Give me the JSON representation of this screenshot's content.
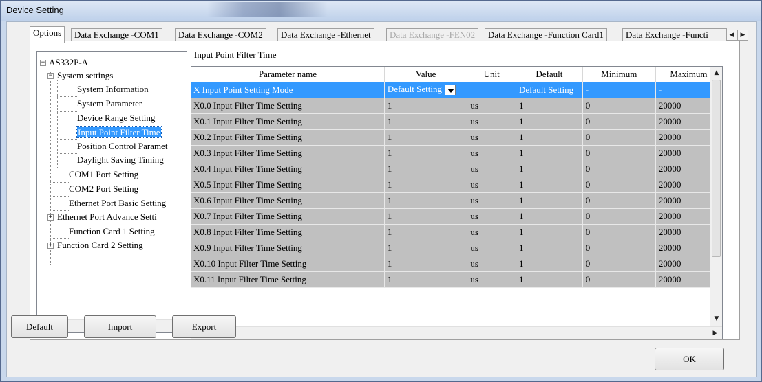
{
  "window": {
    "title": "Device Setting"
  },
  "tabs": [
    {
      "label": "Options",
      "state": "active"
    },
    {
      "label": "Data Exchange -COM1",
      "state": "normal"
    },
    {
      "label": "Data Exchange -COM2",
      "state": "normal"
    },
    {
      "label": "Data Exchange -Ethernet",
      "state": "normal"
    },
    {
      "label": "Data Exchange -FEN02",
      "state": "disabled"
    },
    {
      "label": "Data Exchange -Function Card1",
      "state": "normal"
    },
    {
      "label": "Data Exchange -Functi",
      "state": "normal"
    }
  ],
  "tab_scroll": {
    "left": "◀",
    "right": "▶"
  },
  "tree": {
    "items": [
      {
        "label": "AS332P-A",
        "expander": "−",
        "selected": false
      },
      {
        "label": "System settings",
        "expander": "−",
        "selected": false
      },
      {
        "label": "System Information",
        "selected": false
      },
      {
        "label": "System Parameter",
        "selected": false
      },
      {
        "label": "Device Range Setting",
        "selected": false
      },
      {
        "label": "Input Point Filter Time",
        "selected": true
      },
      {
        "label": "Position Control Paramet",
        "selected": false
      },
      {
        "label": "Daylight Saving Timing",
        "selected": false
      },
      {
        "label": "COM1 Port Setting",
        "selected": false
      },
      {
        "label": "COM2 Port Setting",
        "selected": false
      },
      {
        "label": "Ethernet Port Basic Setting",
        "selected": false
      },
      {
        "label": "Ethernet Port Advance Setti",
        "expander": "+",
        "selected": false
      },
      {
        "label": "Function Card 1 Setting",
        "selected": false
      },
      {
        "label": "Function Card 2 Setting",
        "expander": "+",
        "selected": false
      }
    ],
    "scroll_left": "◀",
    "scroll_right": "▶"
  },
  "grid": {
    "title": "Input Point Filter Time",
    "columns": [
      "Parameter name",
      "Value",
      "Unit",
      "Default",
      "Minimum",
      "Maximum"
    ],
    "rows": [
      {
        "name": "X Input Point Setting Mode",
        "value": "Default Setting",
        "unit": "",
        "default": "Default Setting",
        "min": "-",
        "max": "-",
        "selected": true,
        "dropdown": true
      },
      {
        "name": "X0.0 Input Filter Time Setting",
        "value": "1",
        "unit": "us",
        "default": "1",
        "min": "0",
        "max": "20000"
      },
      {
        "name": "X0.1 Input Filter Time Setting",
        "value": "1",
        "unit": "us",
        "default": "1",
        "min": "0",
        "max": "20000"
      },
      {
        "name": "X0.2 Input Filter Time Setting",
        "value": "1",
        "unit": "us",
        "default": "1",
        "min": "0",
        "max": "20000"
      },
      {
        "name": "X0.3 Input Filter Time Setting",
        "value": "1",
        "unit": "us",
        "default": "1",
        "min": "0",
        "max": "20000"
      },
      {
        "name": "X0.4 Input Filter Time Setting",
        "value": "1",
        "unit": "us",
        "default": "1",
        "min": "0",
        "max": "20000"
      },
      {
        "name": "X0.5 Input Filter Time Setting",
        "value": "1",
        "unit": "us",
        "default": "1",
        "min": "0",
        "max": "20000"
      },
      {
        "name": "X0.6 Input Filter Time Setting",
        "value": "1",
        "unit": "us",
        "default": "1",
        "min": "0",
        "max": "20000"
      },
      {
        "name": "X0.7 Input Filter Time Setting",
        "value": "1",
        "unit": "us",
        "default": "1",
        "min": "0",
        "max": "20000"
      },
      {
        "name": "X0.8 Input Filter Time Setting",
        "value": "1",
        "unit": "us",
        "default": "1",
        "min": "0",
        "max": "20000"
      },
      {
        "name": "X0.9 Input Filter Time Setting",
        "value": "1",
        "unit": "us",
        "default": "1",
        "min": "0",
        "max": "20000"
      },
      {
        "name": "X0.10 Input Filter Time Setting",
        "value": "1",
        "unit": "us",
        "default": "1",
        "min": "0",
        "max": "20000"
      },
      {
        "name": "X0.11 Input Filter Time Setting",
        "value": "1",
        "unit": "us",
        "default": "1",
        "min": "0",
        "max": "20000"
      }
    ],
    "scroll_up": "▲",
    "scroll_down": "▼",
    "scroll_left": "◀",
    "scroll_right": "▶"
  },
  "buttons": {
    "default_label": "Default",
    "import_label": "Import",
    "export_label": "Export",
    "ok_label": "OK"
  },
  "colors": {
    "selection": "#3399ff",
    "row_background": "#c0c0c0",
    "disabled_text": "#a9a9a9"
  }
}
